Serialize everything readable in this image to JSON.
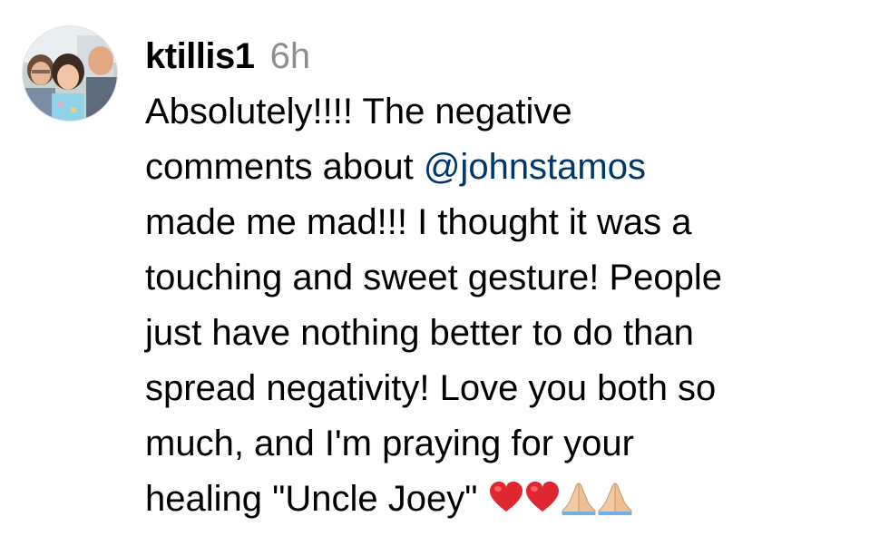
{
  "comment": {
    "username": "ktillis1",
    "timestamp": "6h",
    "lines": [
      {
        "before": "Absolutely!!!! The negative",
        "mention": "",
        "after": ""
      },
      {
        "before": "comments about ",
        "mention": "@johnstamos",
        "after": ""
      },
      {
        "before": "made me mad!!! I thought it was a",
        "mention": "",
        "after": ""
      },
      {
        "before": "touching and sweet gesture! People",
        "mention": "",
        "after": ""
      },
      {
        "before": "just have nothing better to do than",
        "mention": "",
        "after": ""
      },
      {
        "before": "spread negativity! Love you both so",
        "mention": "",
        "after": ""
      },
      {
        "before": "much, and I'm praying for your",
        "mention": "",
        "after": ""
      },
      {
        "before": "healing \"Uncle Joey\" ",
        "mention": "",
        "after": ""
      }
    ],
    "emojis": [
      "red-heart",
      "red-heart",
      "folded-hands",
      "folded-hands"
    ],
    "colors": {
      "mention": "#00376b",
      "timestamp": "#8e8e8e",
      "heart": "#e0262f",
      "hands": "#f2c9a0"
    }
  }
}
